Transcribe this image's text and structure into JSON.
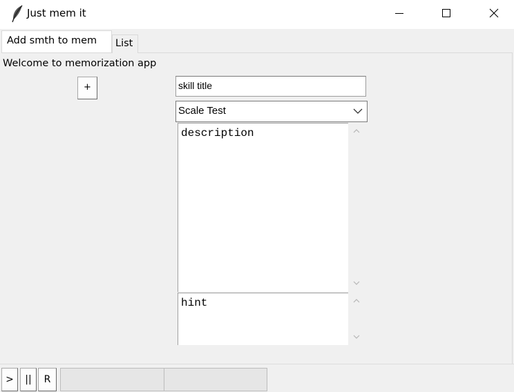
{
  "window": {
    "title": "Just mem it",
    "minimize_glyph": "–",
    "maximize_glyph": "☐",
    "close_glyph": "✕"
  },
  "tabs": [
    {
      "label": "Add smth to mem",
      "active": true
    },
    {
      "label": "List",
      "active": false
    }
  ],
  "main": {
    "welcome": "Welcome to memorization app",
    "add_button": "+",
    "skill_title": {
      "value": "skill title"
    },
    "type_select": {
      "value": "Scale Test"
    },
    "description": {
      "value": "description"
    },
    "hint": {
      "value": "hint"
    }
  },
  "statusbar": {
    "play_label": ">",
    "pause_label": "||",
    "reset_label": "R",
    "progress": 0
  },
  "icons": {
    "app": "feather-icon",
    "minimize": "minimize-icon",
    "maximize": "maximize-icon",
    "close": "close-icon",
    "dropdown": "chevron-down-icon",
    "scroll_up": "chevron-up-icon",
    "scroll_down": "chevron-down-icon"
  }
}
